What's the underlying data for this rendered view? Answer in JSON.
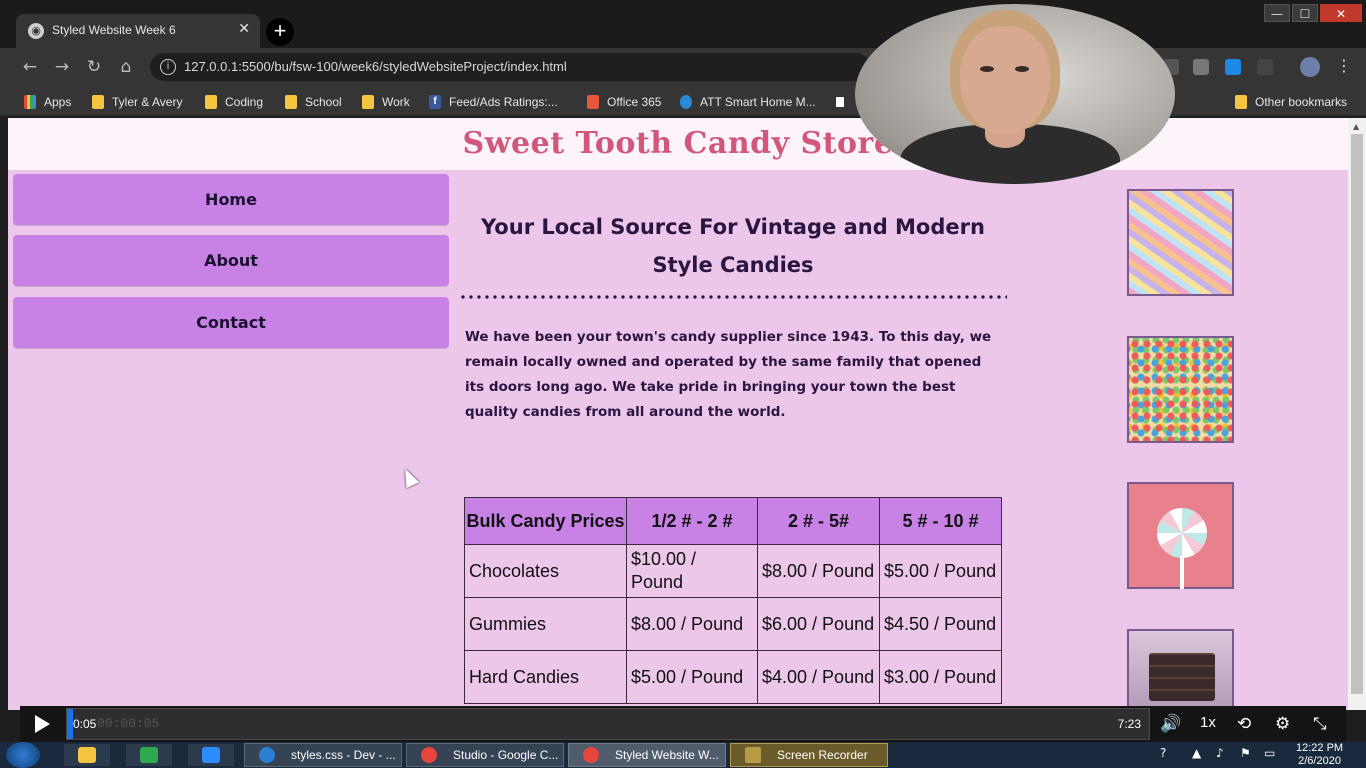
{
  "browser": {
    "tab_title": "Styled Website Week 6",
    "tab_close": "✕",
    "new_tab": "+",
    "url": "127.0.0.1:5500/bu/fsw-100/week6/styledWebsiteProject/index.html",
    "window_controls": {
      "minimize": "—",
      "maximize": "☐",
      "close": "✕"
    },
    "nav_icons": {
      "back": "←",
      "forward": "→",
      "reload": "↻",
      "home": "⌂"
    },
    "bookmarks": [
      {
        "label": "Apps",
        "icon": "apps-icon"
      },
      {
        "label": "Tyler & Avery",
        "icon": "folder-icon"
      },
      {
        "label": "Coding",
        "icon": "folder-icon"
      },
      {
        "label": "School",
        "icon": "folder-icon"
      },
      {
        "label": "Work",
        "icon": "folder-icon"
      },
      {
        "label": "Feed/Ads Ratings:...",
        "icon": "facebook-icon"
      },
      {
        "label": "Office 365",
        "icon": "office-icon"
      },
      {
        "label": "ATT Smart Home M...",
        "icon": "att-icon"
      },
      {
        "label": "Other bookmarks",
        "icon": "folder-icon"
      }
    ]
  },
  "site": {
    "title": "Sweet Tooth Candy Store",
    "nav": [
      {
        "label": "Home"
      },
      {
        "label": "About"
      },
      {
        "label": "Contact"
      }
    ],
    "headline": "Your Local Source For Vintage and Modern Style Candies",
    "intro": "We have been your town's candy supplier since 1943. To this day, we remain locally owned and operated by the same family that opened its doors long ago. We take pride in bringing your town the best quality candies from all around the world.",
    "price_table": {
      "headers": [
        "Bulk Candy Prices",
        "1/2 # - 2 #",
        "2 # - 5#",
        "5 # - 10 #"
      ],
      "rows": [
        [
          "Chocolates",
          "$10.00 / Pound",
          "$8.00 / Pound",
          "$5.00 / Pound"
        ],
        [
          "Gummies",
          "$8.00 / Pound",
          "$6.00 / Pound",
          "$4.50 / Pound"
        ],
        [
          "Hard Candies",
          "$5.00 / Pound",
          "$4.00 / Pound",
          "$3.00 / Pound"
        ]
      ]
    },
    "sidebar_images": [
      "sour-straws-image",
      "jelly-beans-image",
      "lollipop-image",
      "chocolate-bar-image"
    ]
  },
  "player": {
    "current_time": "0:05",
    "ghost_time": "00:00:05",
    "duration": "7:23",
    "speed": "1x",
    "icons": {
      "volume": "🔊",
      "settings": "⚙",
      "loop": "⟲",
      "exit_fullscreen": "⤡"
    }
  },
  "taskbar": {
    "windows": [
      {
        "label": "styles.css - Dev - ...",
        "color": "#2a7fd4"
      },
      {
        "label": "Studio - Google C...",
        "color": "#e8453c"
      },
      {
        "label": "Styled Website W...",
        "color": "#e8453c"
      },
      {
        "label": "Screen Recorder",
        "color": "#b89a44"
      }
    ],
    "time": "12:22 PM",
    "date": "2/6/2020"
  }
}
